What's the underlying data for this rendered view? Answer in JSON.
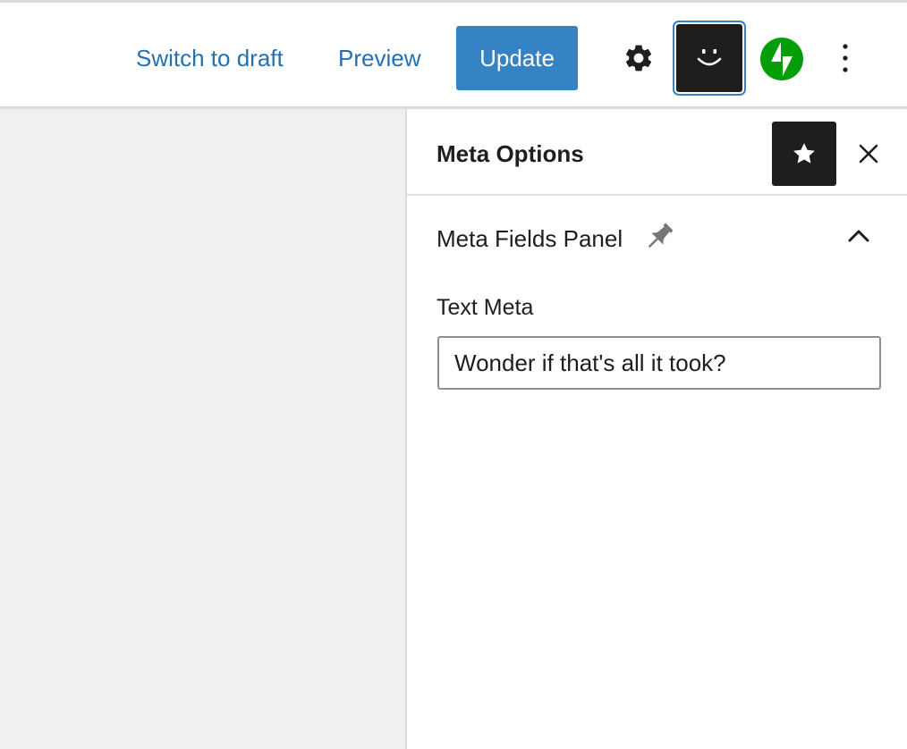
{
  "toolbar": {
    "switch_to_draft_label": "Switch to draft",
    "preview_label": "Preview",
    "update_label": "Update",
    "icons": [
      "gear-icon",
      "smiley-icon",
      "jetpack-bolt-icon",
      "more-vertical-icon"
    ],
    "accent_color": "#2271b1",
    "update_bg_color": "#3582c4",
    "jetpack_color": "#069e08"
  },
  "sidebar": {
    "title": "Meta Options",
    "icons": [
      "star-icon",
      "close-icon"
    ],
    "panel": {
      "title": "Meta Fields Panel",
      "icons": [
        "pin-icon",
        "chevron-up-icon"
      ],
      "field": {
        "label": "Text Meta",
        "value": "Wonder if that's all it took?"
      }
    }
  }
}
